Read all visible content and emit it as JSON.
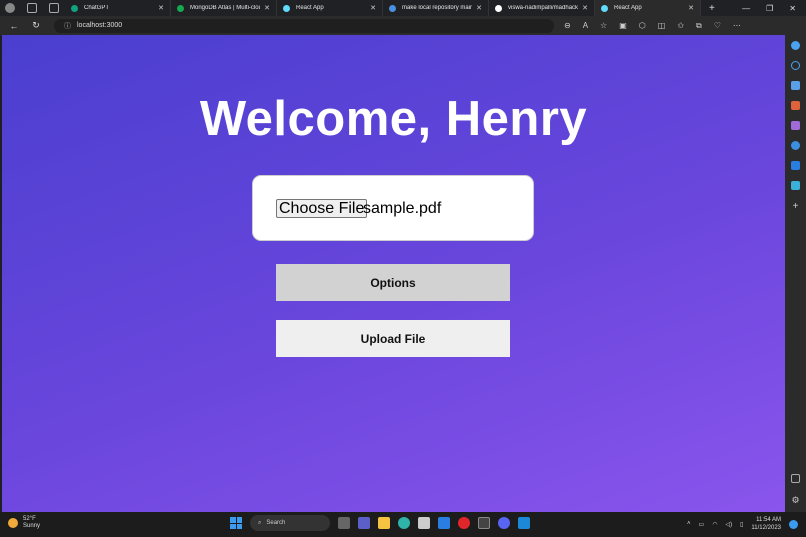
{
  "browser": {
    "tabs": [
      {
        "label": "ChatGPT",
        "color": "#10a37f",
        "active": false
      },
      {
        "label": "MongoDB Atlas | Multi-cloud",
        "color": "#13aa52",
        "active": false
      },
      {
        "label": "React App",
        "color": "#61dafb",
        "active": false
      },
      {
        "label": "make local repository main",
        "color": "#4a90e2",
        "active": false
      },
      {
        "label": "viswa-nadimpalli/madhacks",
        "color": "#ffffff",
        "active": false
      },
      {
        "label": "React App",
        "color": "#61dafb",
        "active": true
      }
    ],
    "url": "localhost:3000"
  },
  "page": {
    "title": "Welcome, Henry",
    "file_input": {
      "button_label": "Choose File",
      "file_name": "sample.pdf"
    },
    "options_label": "Options",
    "upload_label": "Upload File"
  },
  "taskbar": {
    "weather_temp": "52°F",
    "weather_desc": "Sunny",
    "search_label": "Search",
    "time": "11:54 AM",
    "date": "11/12/2023"
  },
  "colors": {
    "gradient_start": "#4a3fcf",
    "gradient_end": "#8a55ec",
    "options_bg": "#d2d2d2",
    "upload_bg": "#efefef"
  }
}
